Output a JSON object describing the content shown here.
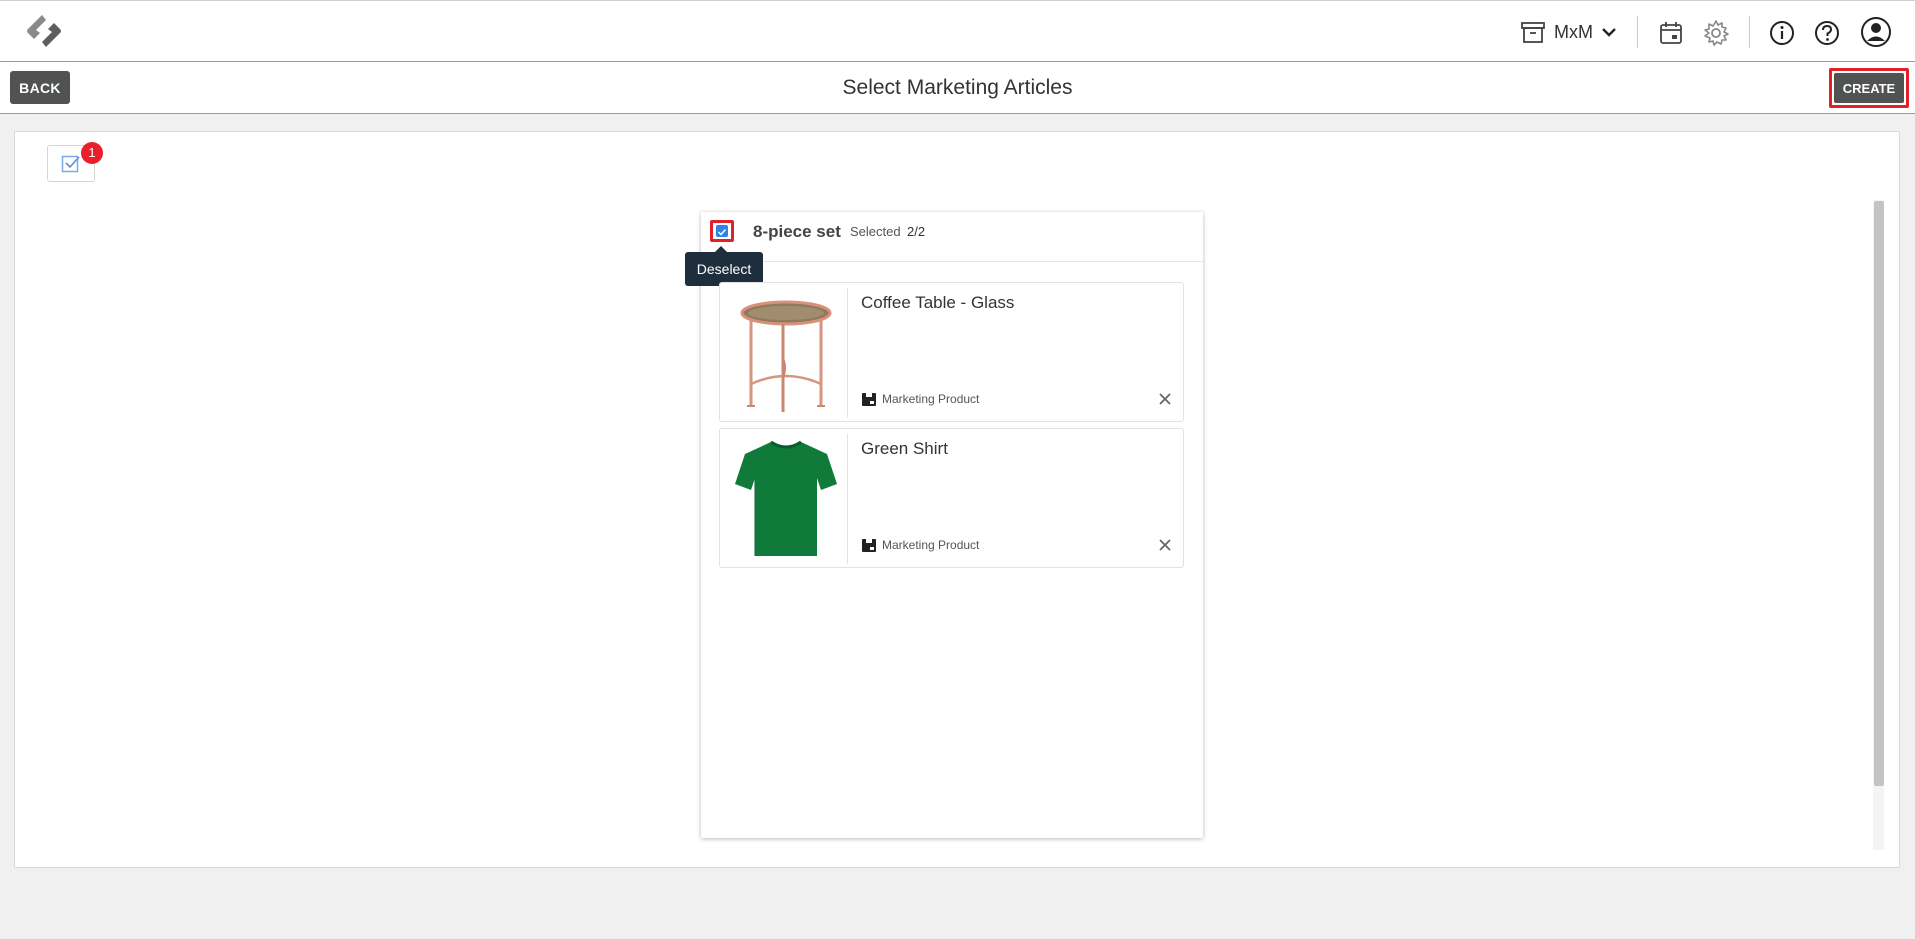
{
  "topbar": {
    "workspace": "MxM",
    "icons": [
      "logo-icon",
      "archive-icon",
      "chevron-down-icon",
      "calendar-icon",
      "gear-icon",
      "info-icon",
      "help-icon",
      "user-icon"
    ]
  },
  "subbar": {
    "back_label": "BACK",
    "title": "Select Marketing Articles",
    "create_label": "CREATE"
  },
  "panel": {
    "selection_badge": "1",
    "set": {
      "name": "8-piece set",
      "selected_label": "Selected",
      "selected_count": "2/2",
      "tooltip": "Deselect",
      "items": [
        {
          "name": "Coffee Table - Glass",
          "type": "Marketing Product"
        },
        {
          "name": "Green Shirt",
          "type": "Marketing Product"
        }
      ]
    }
  },
  "colors": {
    "accent_red": "#e0212a",
    "button_dark": "#505352",
    "checkbox_blue": "#2f84e8",
    "tooltip_bg": "#1f2e3d"
  }
}
